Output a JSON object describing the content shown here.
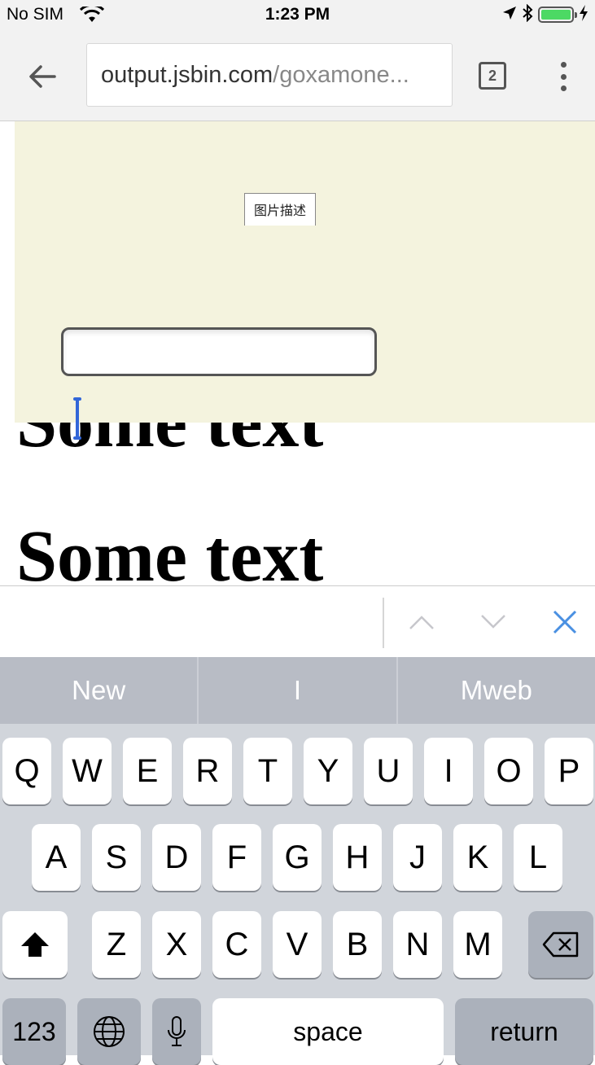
{
  "status_bar": {
    "carrier": "No SIM",
    "time": "1:23 PM",
    "battery_level": 1.0,
    "icons": [
      "wifi-icon",
      "location-arrow-icon",
      "bluetooth-icon",
      "battery-icon",
      "charging-bolt-icon"
    ]
  },
  "toolbar": {
    "url_host": "output.jsbin.com",
    "url_path": "/goxamone...",
    "tab_count": "2",
    "icons": [
      "back-arrow-icon",
      "overflow-menu-icon"
    ]
  },
  "page": {
    "heading_1": "Some text",
    "heading_2": "Some text",
    "image_alt": "图片描述",
    "panel_color": "#f4f3de",
    "input_value": ""
  },
  "accessory_bar": {
    "icons": [
      "chevron-up-icon",
      "chevron-down-icon",
      "close-icon"
    ],
    "accent_color": "#4a90e2"
  },
  "keyboard": {
    "suggestions": [
      "New",
      "I",
      "Mweb"
    ],
    "rows": [
      [
        "Q",
        "W",
        "E",
        "R",
        "T",
        "Y",
        "U",
        "I",
        "O",
        "P"
      ],
      [
        "A",
        "S",
        "D",
        "F",
        "G",
        "H",
        "J",
        "K",
        "L"
      ],
      [
        "Z",
        "X",
        "C",
        "V",
        "B",
        "N",
        "M"
      ]
    ],
    "numbers_label": "123",
    "space_label": "space",
    "return_label": "return",
    "icons": [
      "shift-icon",
      "backspace-icon",
      "globe-icon",
      "microphone-icon"
    ]
  }
}
